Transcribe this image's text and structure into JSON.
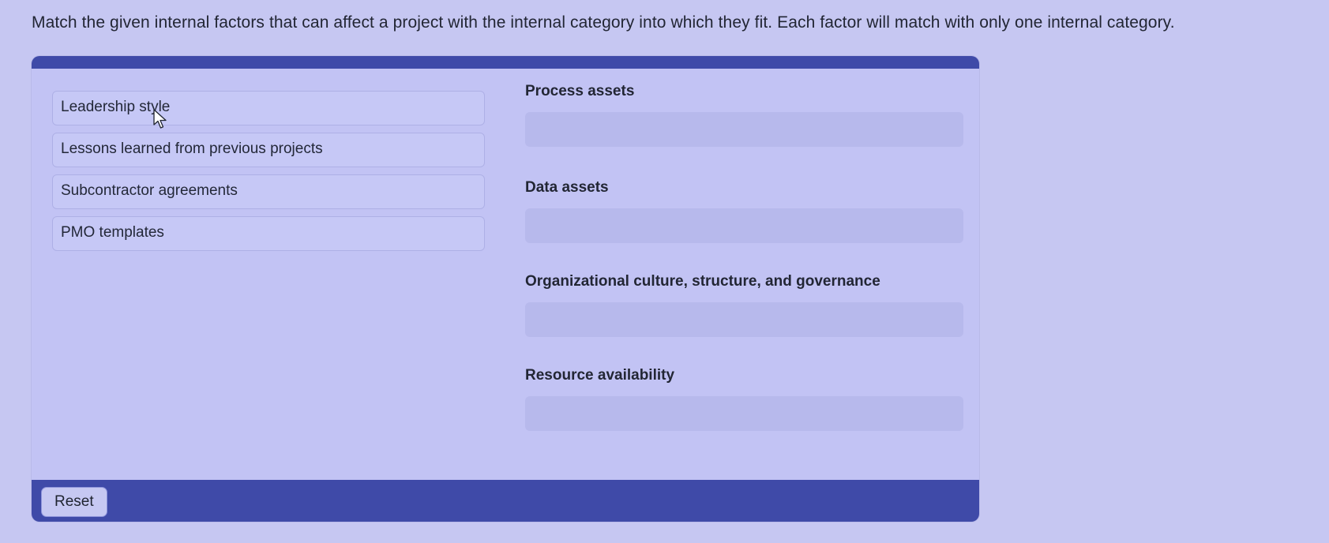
{
  "instructions": "Match the given internal factors that can affect a project with the internal category into which they fit. Each factor will match with only one internal category.",
  "factors": [
    {
      "label": "Leadership style"
    },
    {
      "label": "Lessons learned from previous projects"
    },
    {
      "label": "Subcontractor agreements"
    },
    {
      "label": "PMO templates"
    }
  ],
  "categories": [
    {
      "label": "Process assets",
      "drop_value": ""
    },
    {
      "label": "Data assets",
      "drop_value": ""
    },
    {
      "label": "Organizational culture, structure, and governance",
      "drop_value": ""
    },
    {
      "label": "Resource availability",
      "drop_value": ""
    }
  ],
  "footer": {
    "reset_label": "Reset"
  },
  "colors": {
    "page_background": "#c6c7f2",
    "panel_bar": "#3f4aa8",
    "drop_zone": "#b7b9ec",
    "factor_card": "#c6c8f6"
  },
  "icons": {
    "cursor": "mouse-pointer-icon"
  }
}
